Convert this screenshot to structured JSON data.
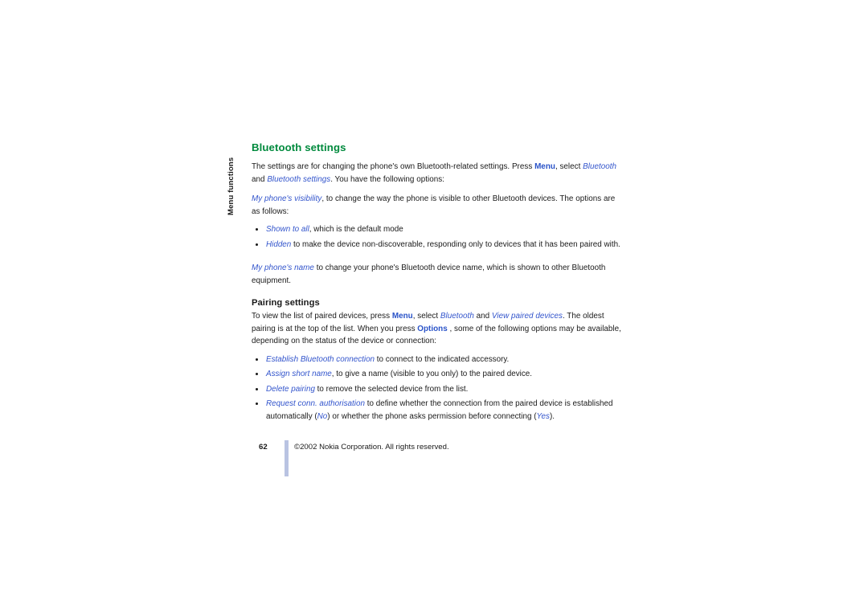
{
  "document": {
    "running_head": "Menu functions",
    "title": "Bluetooth settings",
    "subtitle": "Pairing settings"
  },
  "colors": {
    "heading_green": "#008a3d",
    "link_blue": "#3355cc",
    "bold_blue": "#2a53c8",
    "footer_rule": "#b9c3e2",
    "body_text": "#1a1a1a",
    "page_background": "#ffffff"
  },
  "intro": {
    "seg1": "The settings are for changing the phone's own Bluetooth-related settings. Press ",
    "menu": "Menu",
    "seg2": ", select ",
    "bluetooth": "Bluetooth",
    "seg3": " and ",
    "bluetooth_settings": "Bluetooth settings",
    "seg4": ". You have the following options:"
  },
  "visibility": {
    "term": "My phone's visibility",
    "rest": ", to change the way the phone is visible to other Bluetooth devices. The options are as follows:",
    "options": [
      {
        "term": "Shown to all",
        "rest": ", which is the default mode"
      },
      {
        "term": "Hidden",
        "rest": " to make the device non-discoverable, responding only to devices that it has been paired with."
      }
    ]
  },
  "phone_name": {
    "term": "My phone's name",
    "rest": " to change your phone's Bluetooth device name, which is shown to other Bluetooth equipment."
  },
  "pairing": {
    "seg1": "To view the list of paired devices, press ",
    "menu": "Menu",
    "seg2": ", select ",
    "bluetooth": "Bluetooth",
    "seg3": " and ",
    "view_paired": "View paired devices",
    "seg4": ". The oldest pairing is at the top of the list. When you press ",
    "options_word": "Options",
    "seg5": " , some of the following options may be available, depending on the status of the device or connection:",
    "items": [
      {
        "term": "Establish Bluetooth connection",
        "rest": " to connect to the indicated accessory."
      },
      {
        "term": "Assign short name",
        "rest": ", to give a name (visible to you only) to the paired device."
      },
      {
        "term": "Delete pairing",
        "rest": " to remove the selected device from the list."
      }
    ],
    "last_item": {
      "term": "Request conn. authorisation",
      "seg1": " to define whether the connection from the paired device is established automatically (",
      "no": "No",
      "seg2": ") or  whether the phone asks permission before connecting (",
      "yes": "Yes",
      "seg3": ")."
    }
  },
  "footer": {
    "page_number": "62",
    "copyright": "©2002 Nokia Corporation. All rights reserved."
  }
}
